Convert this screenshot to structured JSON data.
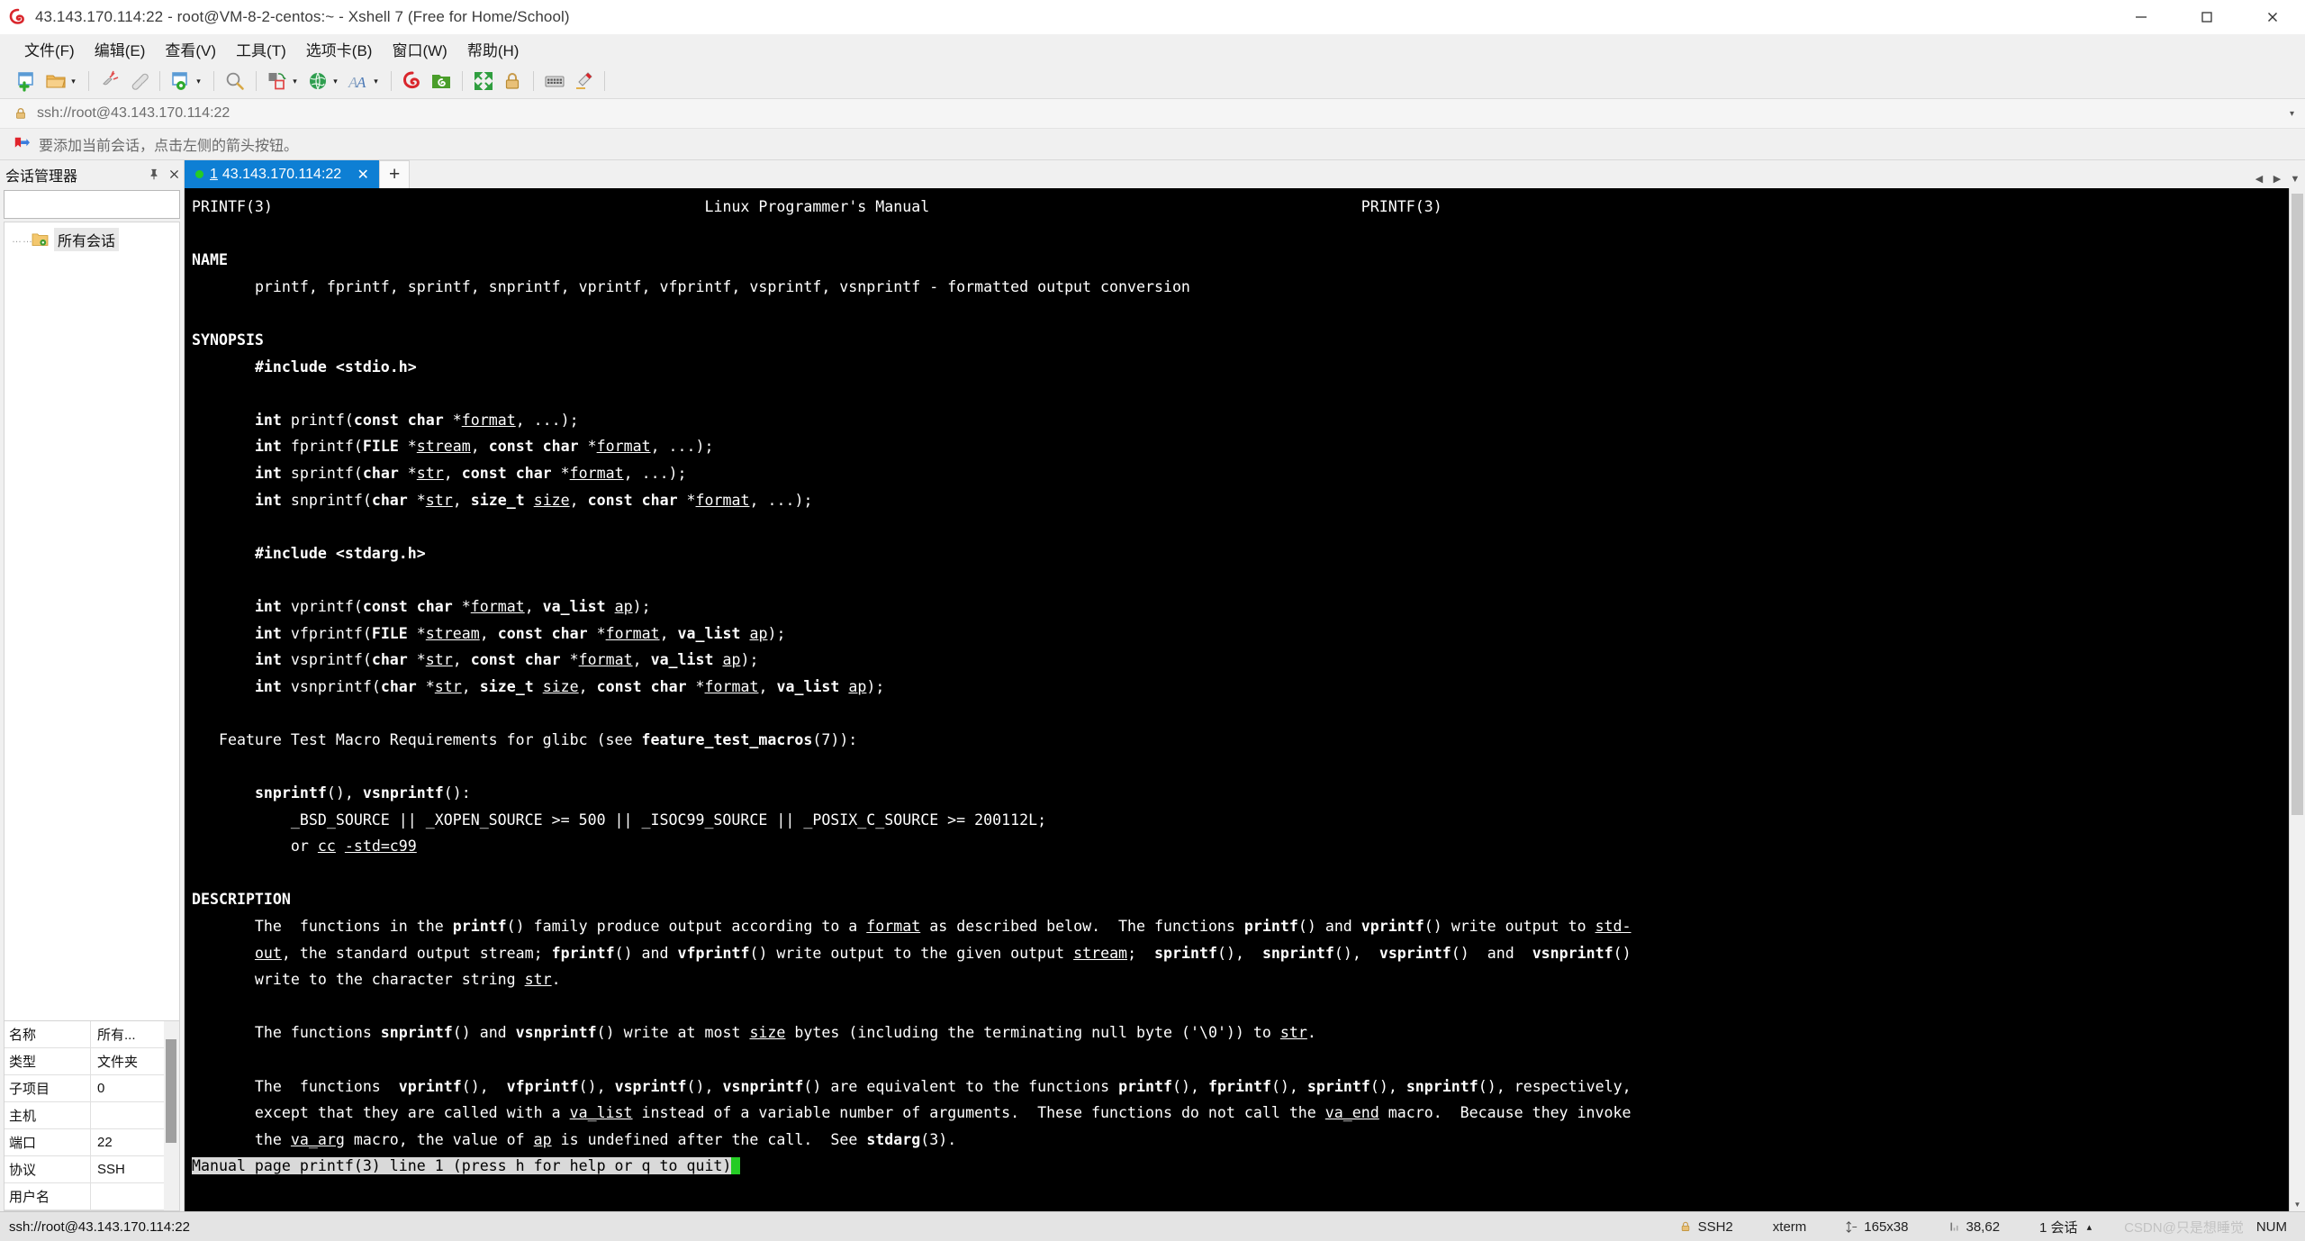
{
  "window": {
    "title": "43.143.170.114:22 - root@VM-8-2-centos:~ - Xshell 7 (Free for Home/School)",
    "minimize": "─",
    "maximize": "☐",
    "close": "✕"
  },
  "menubar": {
    "items": [
      {
        "label": "文件(F)",
        "name": "menu-file"
      },
      {
        "label": "编辑(E)",
        "name": "menu-edit"
      },
      {
        "label": "查看(V)",
        "name": "menu-view"
      },
      {
        "label": "工具(T)",
        "name": "menu-tools"
      },
      {
        "label": "选项卡(B)",
        "name": "menu-tabs"
      },
      {
        "label": "窗口(W)",
        "name": "menu-window"
      },
      {
        "label": "帮助(H)",
        "name": "menu-help"
      }
    ]
  },
  "toolbar": {
    "icons": [
      "new-session-icon",
      "open-folder-icon",
      "disconnect-icon",
      "reconnect-icon",
      "session-properties-icon",
      "find-icon",
      "transfer-file-icon",
      "globe-icon",
      "font-icon",
      "xshell-icon",
      "xftp-icon",
      "fullscreen-icon",
      "lock-icon",
      "keyboard-icon",
      "highlight-icon"
    ],
    "caret": "▾"
  },
  "address": {
    "lock_icon": "lock-icon",
    "url": "ssh://root@43.143.170.114:22",
    "dropdown_caret": "▾"
  },
  "notice": {
    "icon": "bookmark-arrow-icon",
    "text": "要添加当前会话，点击左侧的箭头按钮。"
  },
  "sidebar": {
    "title": "会话管理器",
    "pin_icon": "pin-icon",
    "close_icon": "close-icon",
    "search_placeholder": "",
    "search_value": "",
    "search_icon": "search-icon",
    "tree": [
      {
        "label": "所有会话",
        "icon": "folder-settings-icon"
      }
    ],
    "properties": [
      {
        "key": "名称",
        "value": "所有..."
      },
      {
        "key": "类型",
        "value": "文件夹"
      },
      {
        "key": "子项目",
        "value": "0"
      },
      {
        "key": "主机",
        "value": ""
      },
      {
        "key": "端口",
        "value": "22"
      },
      {
        "key": "协议",
        "value": "SSH"
      },
      {
        "key": "用户名",
        "value": ""
      }
    ]
  },
  "tabs": {
    "items": [
      {
        "number": "1",
        "label": "43.143.170.114:22",
        "active": true,
        "close": "✕"
      }
    ],
    "new_tab": "+"
  },
  "terminal": {
    "header_left": "PRINTF(3)",
    "header_center": "Linux Programmer's Manual",
    "header_right": "PRINTF(3)",
    "sections": {
      "name_heading": "NAME",
      "name_body": "printf, fprintf, sprintf, snprintf, vprintf, vfprintf, vsprintf, vsnprintf - formatted output conversion",
      "synopsis_heading": "SYNOPSIS",
      "include_stdio": "#include <stdio.h>",
      "include_stdarg": "#include <stdarg.h>",
      "protos_stdio": [
        "int printf(const char *format, ...);",
        "int fprintf(FILE *stream, const char *format, ...);",
        "int sprintf(char *str, const char *format, ...);",
        "int snprintf(char *str, size_t size, const char *format, ...);"
      ],
      "protos_stdarg": [
        "int vprintf(const char *format, va_list ap);",
        "int vfprintf(FILE *stream, const char *format, va_list ap);",
        "int vsprintf(char *str, const char *format, va_list ap);",
        "int vsnprintf(char *str, size_t size, const char *format, va_list ap);"
      ],
      "feature_line": "Feature Test Macro Requirements for glibc (see feature_test_macros(7)):",
      "ftm_funcs": "snprintf(), vsnprintf():",
      "ftm_req": "_BSD_SOURCE || _XOPEN_SOURCE >= 500 || _ISOC99_SOURCE || _POSIX_C_SOURCE >= 200112L;",
      "ftm_or": "or cc -std=c99",
      "description_heading": "DESCRIPTION",
      "desc_p1": [
        "The  functions in the printf() family produce output according to a format as described below.  The functions printf() and vprintf() write output to std-",
        "out, the standard output stream; fprintf() and vfprintf() write output to the given output stream;  sprintf(),  snprintf(),  vsprintf()  and  vsnprintf()",
        "write to the character string str."
      ],
      "desc_p2": [
        "The functions snprintf() and vsnprintf() write at most size bytes (including the terminating null byte ('\\0')) to str."
      ],
      "desc_p3": [
        "The  functions  vprintf(),  vfprintf(), vsprintf(), vsnprintf() are equivalent to the functions printf(), fprintf(), sprintf(), snprintf(), respectively,",
        "except that they are called with a va_list instead of a variable number of arguments.  These functions do not call the va_end macro.  Because they invoke",
        "the va_arg macro, the value of ap is undefined after the call.  See stdarg(3)."
      ]
    },
    "status_line": "Manual page printf(3) line 1 (press h for help or q to quit)"
  },
  "statusbar": {
    "connection": "ssh://root@43.143.170.114:22",
    "protocol": "SSH2",
    "protocol_icon": "lock-icon",
    "term_type": "xterm",
    "size": "165x38",
    "size_icon": "resize-icon",
    "cursor": "38,62",
    "cursor_icon": "cursor-icon",
    "sessions": "1 会话",
    "sessions_caret": "▴",
    "watermark": "CSDN@只是想睡觉",
    "num_lock": "NUM"
  },
  "colors": {
    "accent": "#0e7fd4",
    "terminal_bg": "#000000",
    "terminal_fg": "#ffffff",
    "status_bg": "#d9d9d9",
    "chrome_bg": "#f0f0f0",
    "green_dot": "#25cc25"
  }
}
